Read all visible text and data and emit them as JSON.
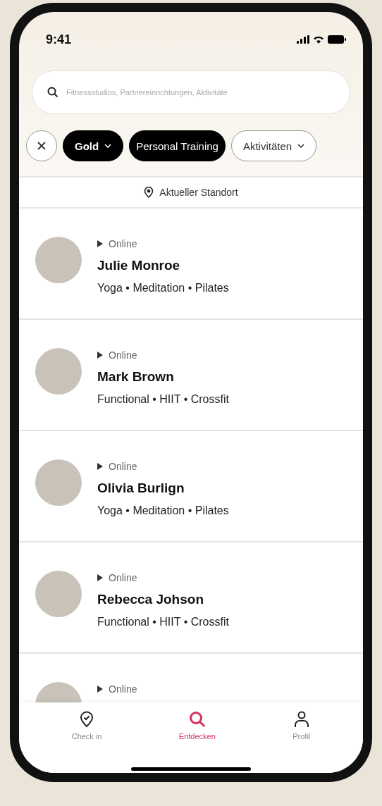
{
  "status_bar": {
    "time": "9:41"
  },
  "search": {
    "placeholder": "Fitnessstudios, Partnereinrichtungen, Aktivitäte"
  },
  "filters": [
    {
      "kind": "clear",
      "selected": false
    },
    {
      "kind": "dropdown",
      "label": "Gold",
      "selected": true
    },
    {
      "kind": "tag",
      "label": "Personal Training",
      "selected": true
    },
    {
      "kind": "dropdown",
      "label": "Aktivitäten",
      "selected": false
    }
  ],
  "location": {
    "label": "Aktueller Standort"
  },
  "trainers": [
    {
      "status": "Online",
      "name": "Julie Monroe",
      "activities": "Yoga • Meditation • Pilates"
    },
    {
      "status": "Online",
      "name": "Mark Brown",
      "activities": "Functional • HIIT • Crossfit"
    },
    {
      "status": "Online",
      "name": "Olivia Burlign",
      "activities": "Yoga • Meditation • Pilates"
    },
    {
      "status": "Online",
      "name": "Rebecca Johson",
      "activities": "Functional • HIIT • Crossfit"
    },
    {
      "status": "Online"
    }
  ],
  "tab_bar": [
    {
      "kind": "checkin",
      "label": "Check in",
      "selected": false
    },
    {
      "kind": "search",
      "label": "Entdecken",
      "selected": true
    },
    {
      "kind": "profile",
      "label": "Profil",
      "selected": false
    }
  ]
}
